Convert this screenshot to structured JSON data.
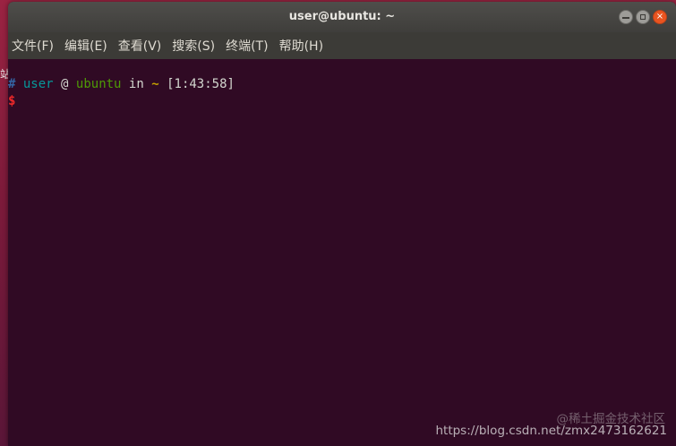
{
  "desktop": {
    "glyph": "站"
  },
  "window": {
    "title": "user@ubuntu: ~",
    "controls": {
      "minimize_icon": "minimize-icon",
      "maximize_icon": "maximize-icon",
      "close_icon": "close-icon",
      "close_glyph": "×"
    }
  },
  "menu": [
    {
      "label": "文件(F)"
    },
    {
      "label": "编辑(E)"
    },
    {
      "label": "查看(V)"
    },
    {
      "label": "搜索(S)"
    },
    {
      "label": "终端(T)"
    },
    {
      "label": "帮助(H)"
    }
  ],
  "terminal": {
    "prompt": {
      "hash": "#",
      "user": "user",
      "at": "@",
      "host": "ubuntu",
      "in": "in",
      "path": "~",
      "time": "[1:43:58]",
      "dollar": "$"
    }
  },
  "watermark": {
    "url": "https://blog.csdn.net/zmx2473162621",
    "site": "@稀土掘金技术社区"
  },
  "colors": {
    "terminal_bg": "#300a24",
    "titlebar": "#4a4945",
    "close_button": "#e95420",
    "user": "#06989a",
    "host": "#4e9a06",
    "tilde": "#c4a000",
    "dollar": "#ef2929"
  }
}
